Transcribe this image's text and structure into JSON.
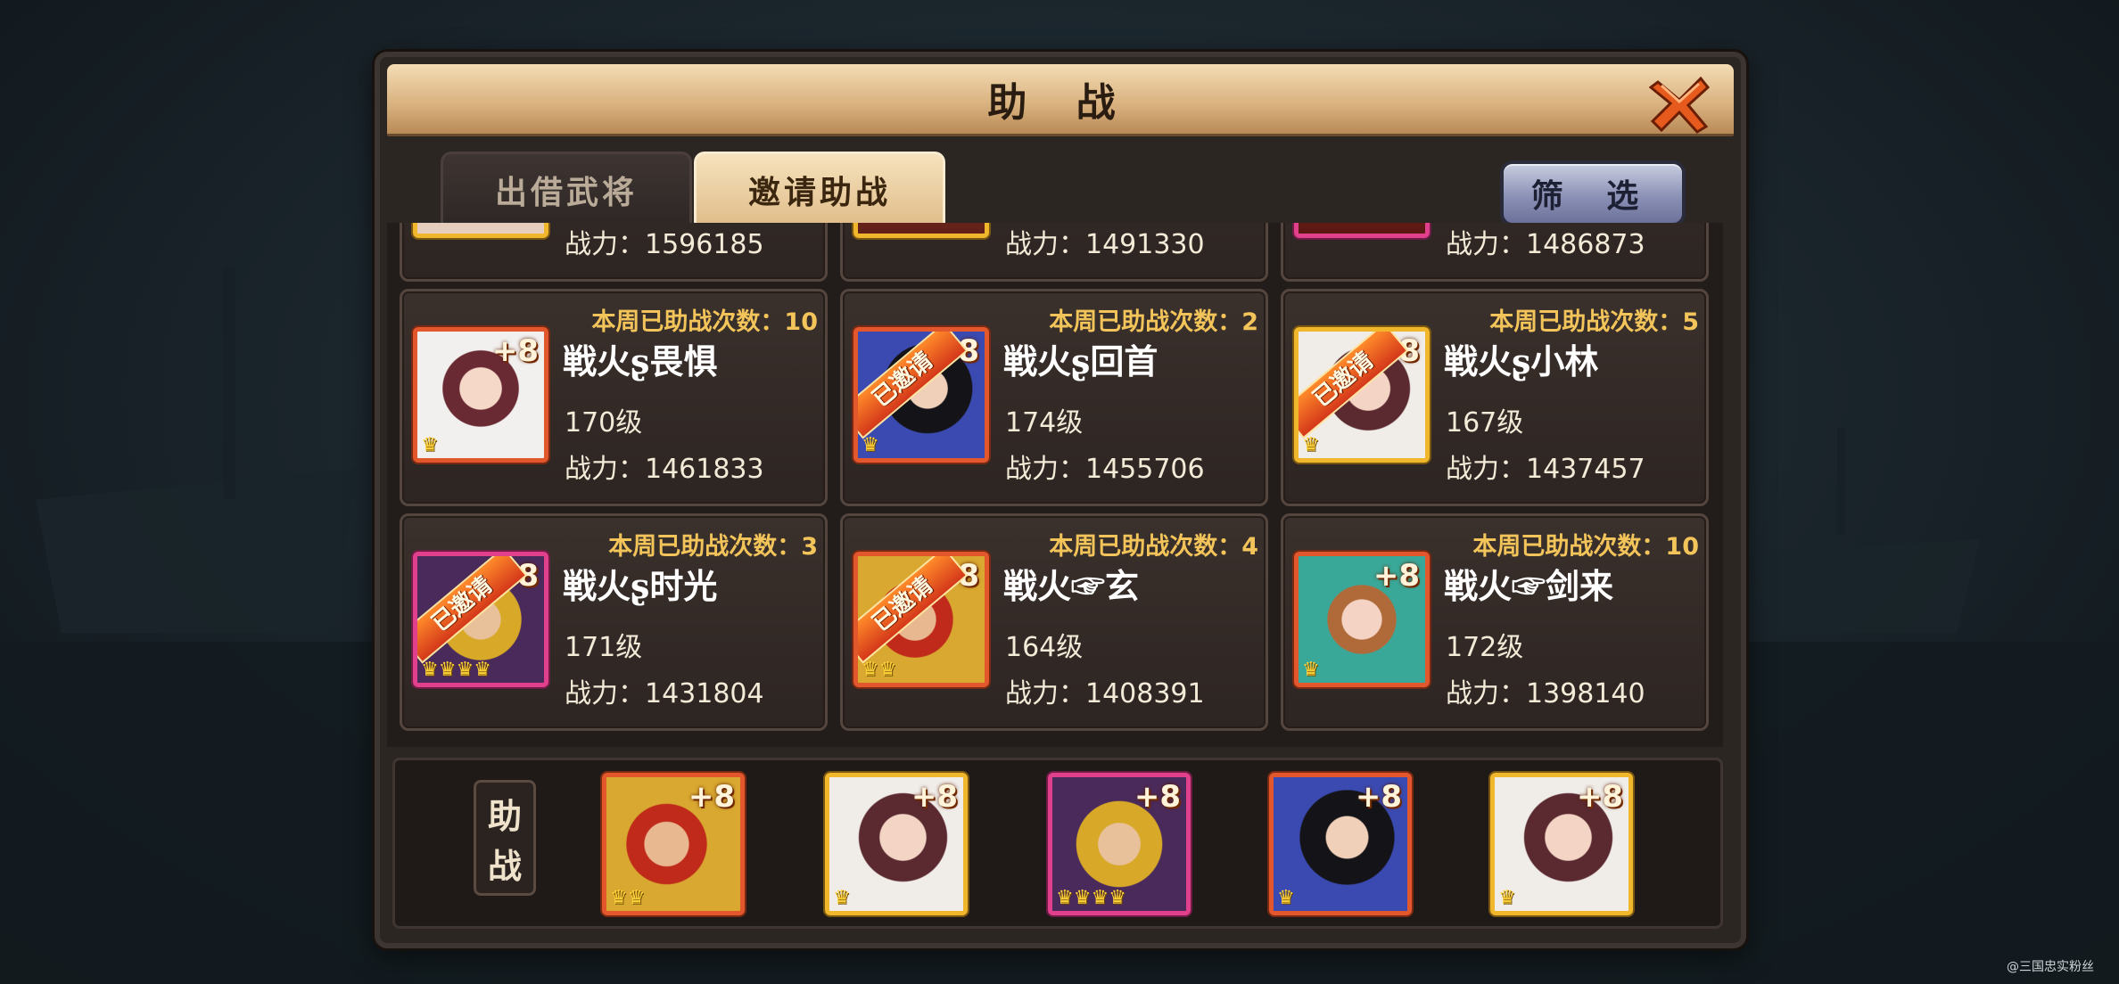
{
  "dialog": {
    "title": "助 战",
    "tabs": [
      {
        "label": "出借武将",
        "active": false
      },
      {
        "label": "邀请助战",
        "active": true
      }
    ],
    "filter_label": "筛 选"
  },
  "partial_row": [
    {
      "power": "战力：1596185"
    },
    {
      "power": "战力：1491330"
    },
    {
      "power": "战力：1486873"
    }
  ],
  "cards": [
    {
      "count": "本周已助战次数：10",
      "name": "戦火ʂ畏惧",
      "level": "170级",
      "power": "战力：1461833",
      "badge": "+8",
      "invited": false,
      "ribbon": "",
      "crowns": "♛",
      "frame": "orange"
    },
    {
      "count": "本周已助战次数：2",
      "name": "戦火ʂ回首",
      "level": "174级",
      "power": "战力：1455706",
      "badge": "+8",
      "invited": true,
      "ribbon": "已邀请",
      "crowns": "♛",
      "frame": "orange"
    },
    {
      "count": "本周已助战次数：5",
      "name": "戦火ʂ小林",
      "level": "167级",
      "power": "战力：1437457",
      "badge": "+8",
      "invited": true,
      "ribbon": "已邀请",
      "crowns": "♛",
      "frame": "gold"
    },
    {
      "count": "本周已助战次数：3",
      "name": "戦火ʂ时光",
      "level": "171级",
      "power": "战力：1431804",
      "badge": "+8",
      "invited": true,
      "ribbon": "已邀请",
      "crowns": "♛♛♛♛",
      "frame": "pink"
    },
    {
      "count": "本周已助战次数：4",
      "name": "戦火☞玄",
      "level": "164级",
      "power": "战力：1408391",
      "badge": "+8",
      "invited": true,
      "ribbon": "已邀请",
      "crowns": "♛♛",
      "frame": "orange"
    },
    {
      "count": "本周已助战次数：10",
      "name": "戦火☞剑来",
      "level": "172级",
      "power": "战力：1398140",
      "badge": "+8",
      "invited": false,
      "ribbon": "",
      "crowns": "♛",
      "frame": "orange"
    }
  ],
  "assist_bar": {
    "label": "助战",
    "slots": [
      {
        "badge": "+8",
        "crowns": "♛♛",
        "frame": "orange",
        "portrait": "red-helmet-general"
      },
      {
        "badge": "+8",
        "crowns": "♛",
        "frame": "gold",
        "portrait": "female-hero"
      },
      {
        "badge": "+8",
        "crowns": "♛♛♛♛",
        "frame": "pink",
        "portrait": "gold-helmet-general"
      },
      {
        "badge": "+8",
        "crowns": "♛",
        "frame": "orange",
        "portrait": "long-hair-hero"
      },
      {
        "badge": "+8",
        "crowns": "♛",
        "frame": "gold",
        "portrait": "female-hero"
      }
    ]
  },
  "watermark": "@三国忠实粉丝",
  "colors": {
    "count_text": "#f2c45a",
    "frame_orange": "#e2582c",
    "frame_gold": "#f0b62c",
    "frame_pink": "#e0408c"
  }
}
